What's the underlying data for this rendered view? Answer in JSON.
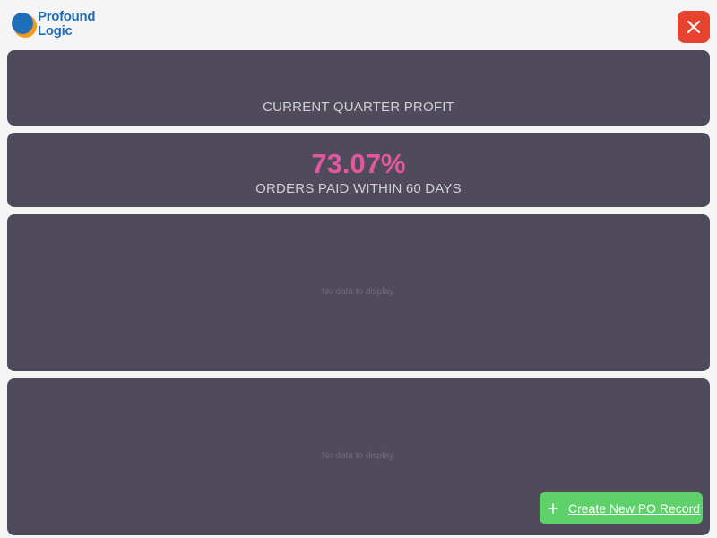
{
  "header": {
    "logo_line1": "Profound",
    "logo_line2": "Logic",
    "close_icon": "close-icon",
    "close_color": "#e8432f"
  },
  "kpis": [
    {
      "value": "",
      "label": "CURRENT QUARTER PROFIT"
    },
    {
      "value": "73.07%",
      "label": "ORDERS PAID WITHIN 60 DAYS",
      "value_color": "#e2589f"
    }
  ],
  "charts": [
    {
      "empty_text": "No data to display."
    },
    {
      "empty_text": "No data to display."
    }
  ],
  "actions": {
    "create_label": "Create New PO Record",
    "create_icon": "plus-icon",
    "create_color": "#5ed16a"
  },
  "colors": {
    "panel_bg": "#4f4b5b",
    "page_bg": "#f5f5f5"
  }
}
